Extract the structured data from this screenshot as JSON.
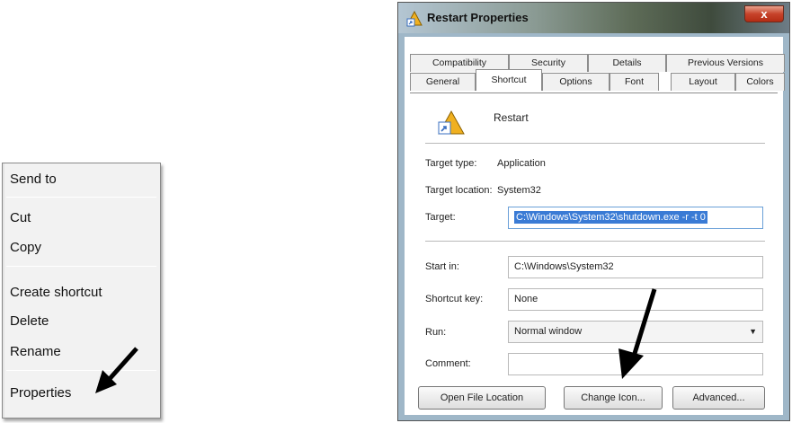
{
  "context_menu": {
    "items": [
      "Send to",
      "Cut",
      "Copy",
      "Create shortcut",
      "Delete",
      "Rename",
      "Properties"
    ]
  },
  "dialog": {
    "title": "Restart Properties",
    "close_glyph": "x",
    "tabs_back": [
      "Compatibility",
      "Security",
      "Details",
      "Previous Versions"
    ],
    "tabs_front": [
      "General",
      "Shortcut",
      "Options",
      "Font",
      "Layout",
      "Colors"
    ],
    "active_tab": "Shortcut",
    "shortcut_name": "Restart",
    "target_type_label": "Target type:",
    "target_type_value": "Application",
    "target_location_label": "Target location:",
    "target_location_value": "System32",
    "target_label": "Target:",
    "target_value": "C:\\Windows\\System32\\shutdown.exe -r -t 0",
    "start_in_label": "Start in:",
    "start_in_value": "C:\\Windows\\System32",
    "shortcut_key_label": "Shortcut key:",
    "shortcut_key_value": "None",
    "run_label": "Run:",
    "run_value": "Normal window",
    "comment_label": "Comment:",
    "comment_value": "",
    "buttons": {
      "open_file_location": "Open File Location",
      "change_icon": "Change Icon...",
      "advanced": "Advanced..."
    }
  }
}
